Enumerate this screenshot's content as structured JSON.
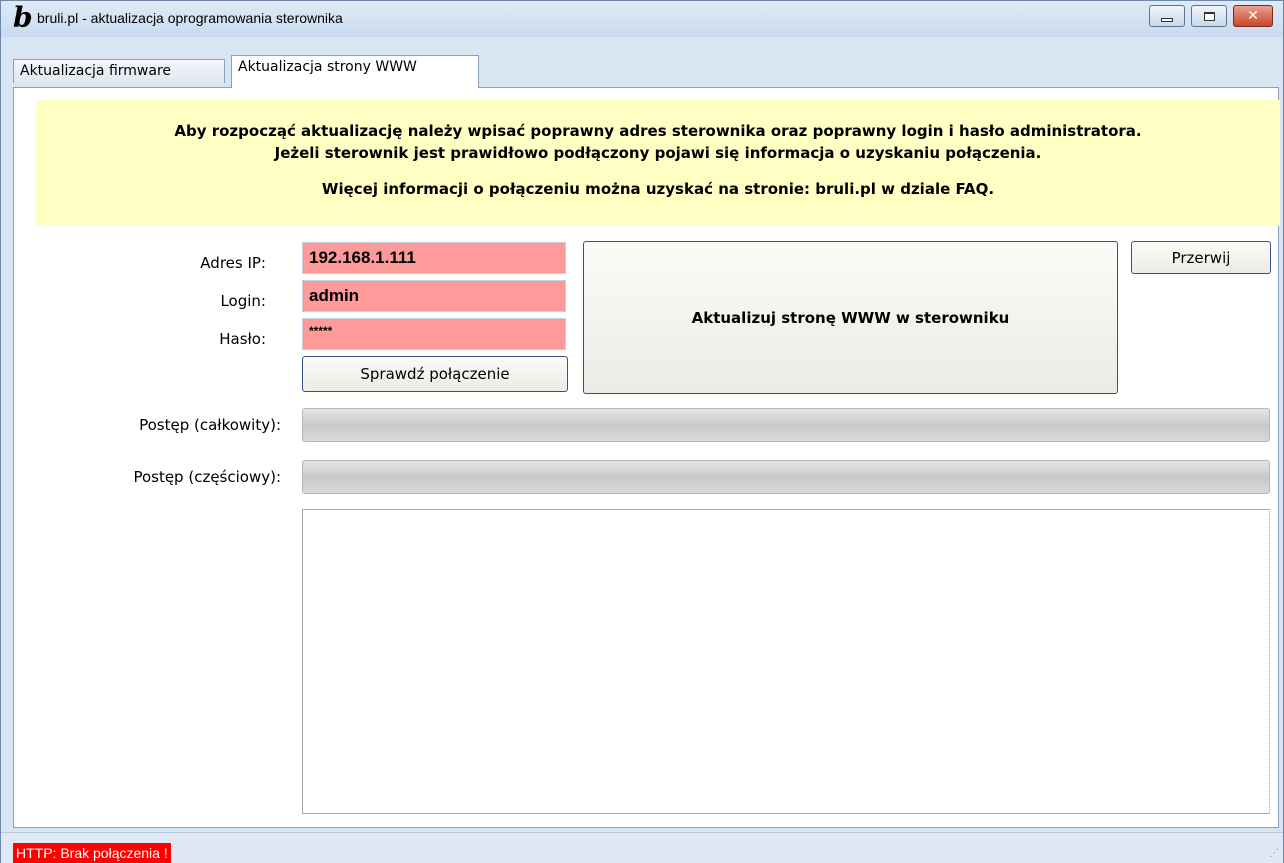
{
  "window": {
    "title": "bruli.pl - aktualizacja oprogramowania sterownika",
    "logo_letter": "b"
  },
  "tabs": [
    {
      "label": "Aktualizacja firmware",
      "active": false
    },
    {
      "label": "Aktualizacja strony WWW",
      "active": true
    }
  ],
  "info": {
    "line1": "Aby rozpocząć aktualizację należy wpisać poprawny adres sterownika oraz poprawny login i hasło administratora.",
    "line2": "Jeżeli sterownik jest prawidłowo podłączony pojawi się informacja o uzyskaniu połączenia.",
    "line3": "Więcej informacji o połączeniu można uzyskać na stronie: bruli.pl w dziale FAQ."
  },
  "form": {
    "ip_label": "Adres IP:",
    "ip_value": "192.168.1.111",
    "login_label": "Login:",
    "login_value": "admin",
    "password_label": "Hasło:",
    "password_value": "*****",
    "field_invalid_color": "#ff9a9a"
  },
  "buttons": {
    "check": "Sprawdź połączenie",
    "update": "Aktualizuj stronę WWW w sterowniku",
    "abort": "Przerwij"
  },
  "progress": {
    "total_label": "Postęp (całkowity):",
    "total_value": 0,
    "partial_label": "Postęp (częściowy):",
    "partial_value": 0
  },
  "log": {
    "text": ""
  },
  "status": {
    "text": "HTTP: Brak połączenia !",
    "color": "#ff0000"
  }
}
